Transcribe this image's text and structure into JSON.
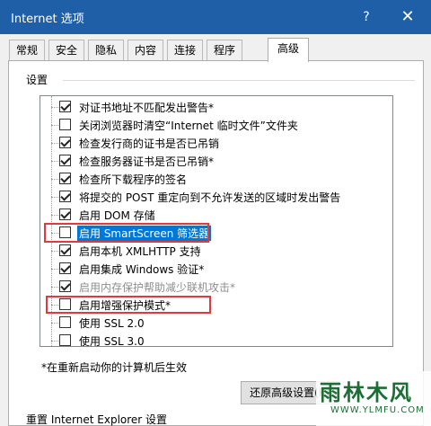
{
  "window": {
    "title": "Internet 选项",
    "help_glyph": "?",
    "close_glyph": "✕"
  },
  "tabs": [
    {
      "label": "常规",
      "active": false
    },
    {
      "label": "安全",
      "active": false
    },
    {
      "label": "隐私",
      "active": false
    },
    {
      "label": "内容",
      "active": false
    },
    {
      "label": "连接",
      "active": false
    },
    {
      "label": "程序",
      "active": false
    },
    {
      "label": "高级",
      "active": true
    }
  ],
  "settings": {
    "group_label": "设置",
    "items": [
      {
        "label": "对证书地址不匹配发出警告*",
        "checked": true,
        "disabled": false,
        "selected": false
      },
      {
        "label": "关闭浏览器时清空“Internet 临时文件”文件夹",
        "checked": false,
        "disabled": false,
        "selected": false
      },
      {
        "label": "检查发行商的证书是否已吊销",
        "checked": true,
        "disabled": false,
        "selected": false
      },
      {
        "label": "检查服务器证书是否已吊销*",
        "checked": true,
        "disabled": false,
        "selected": false
      },
      {
        "label": "检查所下载程序的签名",
        "checked": true,
        "disabled": false,
        "selected": false
      },
      {
        "label": "将提交的 POST 重定向到不允许发送的区域时发出警告",
        "checked": true,
        "disabled": false,
        "selected": false
      },
      {
        "label": "启用 DOM 存储",
        "checked": true,
        "disabled": false,
        "selected": false
      },
      {
        "label": "启用 SmartScreen 筛选器",
        "checked": false,
        "disabled": false,
        "selected": true
      },
      {
        "label": "启用本机 XMLHTTP 支持",
        "checked": true,
        "disabled": false,
        "selected": false
      },
      {
        "label": "启用集成 Windows 验证*",
        "checked": true,
        "disabled": false,
        "selected": false
      },
      {
        "label": "启用内存保护帮助减少联机攻击*",
        "checked": true,
        "disabled": true,
        "selected": false
      },
      {
        "label": "启用增强保护模式*",
        "checked": false,
        "disabled": false,
        "selected": false
      },
      {
        "label": "使用 SSL 2.0",
        "checked": false,
        "disabled": false,
        "selected": false
      },
      {
        "label": "使用 SSL 3.0",
        "checked": false,
        "disabled": false,
        "selected": false
      }
    ]
  },
  "scrollbar": {
    "up_glyph": "▲",
    "down_glyph": "▼"
  },
  "footer": {
    "restart_note": "*在重新启动你的计算机后生效",
    "restore_button": "还原高级设置(R)",
    "reset_section_label": "重置 Internet Explorer 设置"
  },
  "watermark": {
    "text": "雨林木风",
    "url": "WWW.YLMFU.COM"
  },
  "colors": {
    "title_bar": "#1f5fa8",
    "selection": "#0078d7",
    "highlight_box": "#e0393e",
    "watermark": "#1c6e34"
  }
}
